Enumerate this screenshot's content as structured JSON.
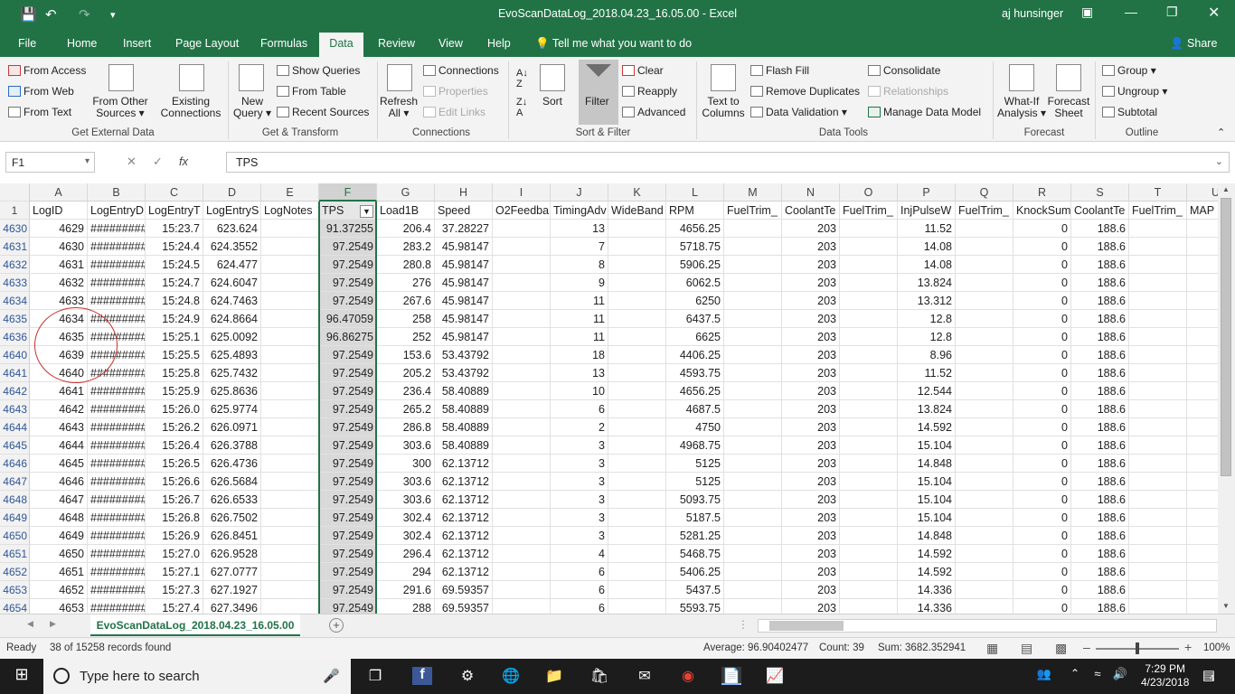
{
  "app": {
    "title": "EvoScanDataLog_2018.04.23_16.05.00  -  Excel",
    "user": "aj hunsinger"
  },
  "menu": {
    "tabs": [
      "File",
      "Home",
      "Insert",
      "Page Layout",
      "Formulas",
      "Data",
      "Review",
      "View",
      "Help"
    ],
    "tell_me": "Tell me what you want to do",
    "share": "Share"
  },
  "ribbon": {
    "get_external": {
      "from_access": "From Access",
      "from_web": "From Web",
      "from_text": "From Text",
      "from_other_1": "From Other",
      "from_other_2": "Sources",
      "existing_1": "Existing",
      "existing_2": "Connections",
      "label": "Get External Data"
    },
    "get_transform": {
      "new_query_1": "New",
      "new_query_2": "Query",
      "show_queries": "Show Queries",
      "from_table": "From Table",
      "recent_sources": "Recent Sources",
      "label": "Get & Transform"
    },
    "connections": {
      "refresh_1": "Refresh",
      "refresh_2": "All",
      "connections": "Connections",
      "properties": "Properties",
      "edit_links": "Edit Links",
      "label": "Connections"
    },
    "sort_filter": {
      "sort": "Sort",
      "filter": "Filter",
      "clear": "Clear",
      "reapply": "Reapply",
      "advanced": "Advanced",
      "label": "Sort & Filter"
    },
    "data_tools": {
      "text_to_1": "Text to",
      "text_to_2": "Columns",
      "flash_fill": "Flash Fill",
      "remove_duplicates": "Remove Duplicates",
      "data_validation": "Data Validation",
      "consolidate": "Consolidate",
      "relationships": "Relationships",
      "manage_model": "Manage Data Model",
      "label": "Data Tools"
    },
    "forecast": {
      "whatif_1": "What-If",
      "whatif_2": "Analysis",
      "sheet_1": "Forecast",
      "sheet_2": "Sheet",
      "label": "Forecast"
    },
    "outline": {
      "group": "Group",
      "ungroup": "Ungroup",
      "subtotal": "Subtotal",
      "label": "Outline"
    }
  },
  "formula_bar": {
    "name_box": "F1",
    "fx": "fx",
    "content": "TPS"
  },
  "grid": {
    "columns": [
      "A",
      "B",
      "C",
      "D",
      "E",
      "F",
      "G",
      "H",
      "I",
      "J",
      "K",
      "L",
      "M",
      "N",
      "O",
      "P",
      "Q",
      "R",
      "S",
      "T",
      "U"
    ],
    "headers": [
      "LogID",
      "LogEntryD",
      "LogEntryT",
      "LogEntryS",
      "LogNotes",
      "TPS",
      "Load1B",
      "Speed",
      "O2Feedba",
      "TimingAdv",
      "WideBand",
      "RPM",
      "FuelTrim_",
      "CoolantTe",
      "FuelTrim_",
      "InjPulseW",
      "FuelTrim_",
      "KnockSum",
      "CoolantTe",
      "FuelTrim_",
      "MAP"
    ],
    "row_numbers": [
      "4630",
      "4631",
      "4632",
      "4633",
      "4634",
      "4635",
      "4636",
      "4640",
      "4641",
      "4642",
      "4643",
      "4644",
      "4645",
      "4646",
      "4647",
      "4648",
      "4649",
      "4650",
      "4651",
      "4652",
      "4653",
      "4654"
    ],
    "rows": [
      [
        "4629",
        "#########",
        "15:23.7",
        "623.624",
        "",
        "91.37255",
        "206.4",
        "37.28227",
        "",
        "13",
        "",
        "4656.25",
        "",
        "203",
        "",
        "11.52",
        "",
        "0",
        "188.6",
        "",
        ""
      ],
      [
        "4630",
        "#########",
        "15:24.4",
        "624.3552",
        "",
        "97.2549",
        "283.2",
        "45.98147",
        "",
        "7",
        "",
        "5718.75",
        "",
        "203",
        "",
        "14.08",
        "",
        "0",
        "188.6",
        "",
        ""
      ],
      [
        "4631",
        "#########",
        "15:24.5",
        "624.477",
        "",
        "97.2549",
        "280.8",
        "45.98147",
        "",
        "8",
        "",
        "5906.25",
        "",
        "203",
        "",
        "14.08",
        "",
        "0",
        "188.6",
        "",
        ""
      ],
      [
        "4632",
        "#########",
        "15:24.7",
        "624.6047",
        "",
        "97.2549",
        "276",
        "45.98147",
        "",
        "9",
        "",
        "6062.5",
        "",
        "203",
        "",
        "13.824",
        "",
        "0",
        "188.6",
        "",
        ""
      ],
      [
        "4633",
        "#########",
        "15:24.8",
        "624.7463",
        "",
        "97.2549",
        "267.6",
        "45.98147",
        "",
        "11",
        "",
        "6250",
        "",
        "203",
        "",
        "13.312",
        "",
        "0",
        "188.6",
        "",
        ""
      ],
      [
        "4634",
        "#########",
        "15:24.9",
        "624.8664",
        "",
        "96.47059",
        "258",
        "45.98147",
        "",
        "11",
        "",
        "6437.5",
        "",
        "203",
        "",
        "12.8",
        "",
        "0",
        "188.6",
        "",
        ""
      ],
      [
        "4635",
        "#########",
        "15:25.1",
        "625.0092",
        "",
        "96.86275",
        "252",
        "45.98147",
        "",
        "11",
        "",
        "6625",
        "",
        "203",
        "",
        "12.8",
        "",
        "0",
        "188.6",
        "",
        ""
      ],
      [
        "4639",
        "#########",
        "15:25.5",
        "625.4893",
        "",
        "97.2549",
        "153.6",
        "53.43792",
        "",
        "18",
        "",
        "4406.25",
        "",
        "203",
        "",
        "8.96",
        "",
        "0",
        "188.6",
        "",
        ""
      ],
      [
        "4640",
        "#########",
        "15:25.8",
        "625.7432",
        "",
        "97.2549",
        "205.2",
        "53.43792",
        "",
        "13",
        "",
        "4593.75",
        "",
        "203",
        "",
        "11.52",
        "",
        "0",
        "188.6",
        "",
        ""
      ],
      [
        "4641",
        "#########",
        "15:25.9",
        "625.8636",
        "",
        "97.2549",
        "236.4",
        "58.40889",
        "",
        "10",
        "",
        "4656.25",
        "",
        "203",
        "",
        "12.544",
        "",
        "0",
        "188.6",
        "",
        ""
      ],
      [
        "4642",
        "#########",
        "15:26.0",
        "625.9774",
        "",
        "97.2549",
        "265.2",
        "58.40889",
        "",
        "6",
        "",
        "4687.5",
        "",
        "203",
        "",
        "13.824",
        "",
        "0",
        "188.6",
        "",
        ""
      ],
      [
        "4643",
        "#########",
        "15:26.2",
        "626.0971",
        "",
        "97.2549",
        "286.8",
        "58.40889",
        "",
        "2",
        "",
        "4750",
        "",
        "203",
        "",
        "14.592",
        "",
        "0",
        "188.6",
        "",
        ""
      ],
      [
        "4644",
        "#########",
        "15:26.4",
        "626.3788",
        "",
        "97.2549",
        "303.6",
        "58.40889",
        "",
        "3",
        "",
        "4968.75",
        "",
        "203",
        "",
        "15.104",
        "",
        "0",
        "188.6",
        "",
        ""
      ],
      [
        "4645",
        "#########",
        "15:26.5",
        "626.4736",
        "",
        "97.2549",
        "300",
        "62.13712",
        "",
        "3",
        "",
        "5125",
        "",
        "203",
        "",
        "14.848",
        "",
        "0",
        "188.6",
        "",
        ""
      ],
      [
        "4646",
        "#########",
        "15:26.6",
        "626.5684",
        "",
        "97.2549",
        "303.6",
        "62.13712",
        "",
        "3",
        "",
        "5125",
        "",
        "203",
        "",
        "15.104",
        "",
        "0",
        "188.6",
        "",
        ""
      ],
      [
        "4647",
        "#########",
        "15:26.7",
        "626.6533",
        "",
        "97.2549",
        "303.6",
        "62.13712",
        "",
        "3",
        "",
        "5093.75",
        "",
        "203",
        "",
        "15.104",
        "",
        "0",
        "188.6",
        "",
        ""
      ],
      [
        "4648",
        "#########",
        "15:26.8",
        "626.7502",
        "",
        "97.2549",
        "302.4",
        "62.13712",
        "",
        "3",
        "",
        "5187.5",
        "",
        "203",
        "",
        "15.104",
        "",
        "0",
        "188.6",
        "",
        ""
      ],
      [
        "4649",
        "#########",
        "15:26.9",
        "626.8451",
        "",
        "97.2549",
        "302.4",
        "62.13712",
        "",
        "3",
        "",
        "5281.25",
        "",
        "203",
        "",
        "14.848",
        "",
        "0",
        "188.6",
        "",
        ""
      ],
      [
        "4650",
        "#########",
        "15:27.0",
        "626.9528",
        "",
        "97.2549",
        "296.4",
        "62.13712",
        "",
        "4",
        "",
        "5468.75",
        "",
        "203",
        "",
        "14.592",
        "",
        "0",
        "188.6",
        "",
        ""
      ],
      [
        "4651",
        "#########",
        "15:27.1",
        "627.0777",
        "",
        "97.2549",
        "294",
        "62.13712",
        "",
        "6",
        "",
        "5406.25",
        "",
        "203",
        "",
        "14.592",
        "",
        "0",
        "188.6",
        "",
        ""
      ],
      [
        "4652",
        "#########",
        "15:27.3",
        "627.1927",
        "",
        "97.2549",
        "291.6",
        "69.59357",
        "",
        "6",
        "",
        "5437.5",
        "",
        "203",
        "",
        "14.336",
        "",
        "0",
        "188.6",
        "",
        ""
      ],
      [
        "4653",
        "#########",
        "15:27.4",
        "627.3496",
        "",
        "97.2549",
        "288",
        "69.59357",
        "",
        "6",
        "",
        "5593.75",
        "",
        "203",
        "",
        "14.336",
        "",
        "0",
        "188.6",
        "",
        ""
      ]
    ]
  },
  "sheet": {
    "tab": "EvoScanDataLog_2018.04.23_16.05.00"
  },
  "status": {
    "ready": "Ready",
    "records": "38 of 15258 records found",
    "average": "Average: 96.90402477",
    "count": "Count: 39",
    "sum": "Sum: 3682.352941",
    "zoom": "100%"
  },
  "taskbar": {
    "search": "Type here to search",
    "time": "7:29 PM",
    "date": "4/23/2018",
    "notifications": "4"
  },
  "colors": {
    "excel_green": "#217346",
    "annotation_red": "#c9302c",
    "row_link_blue": "#2f5597"
  }
}
